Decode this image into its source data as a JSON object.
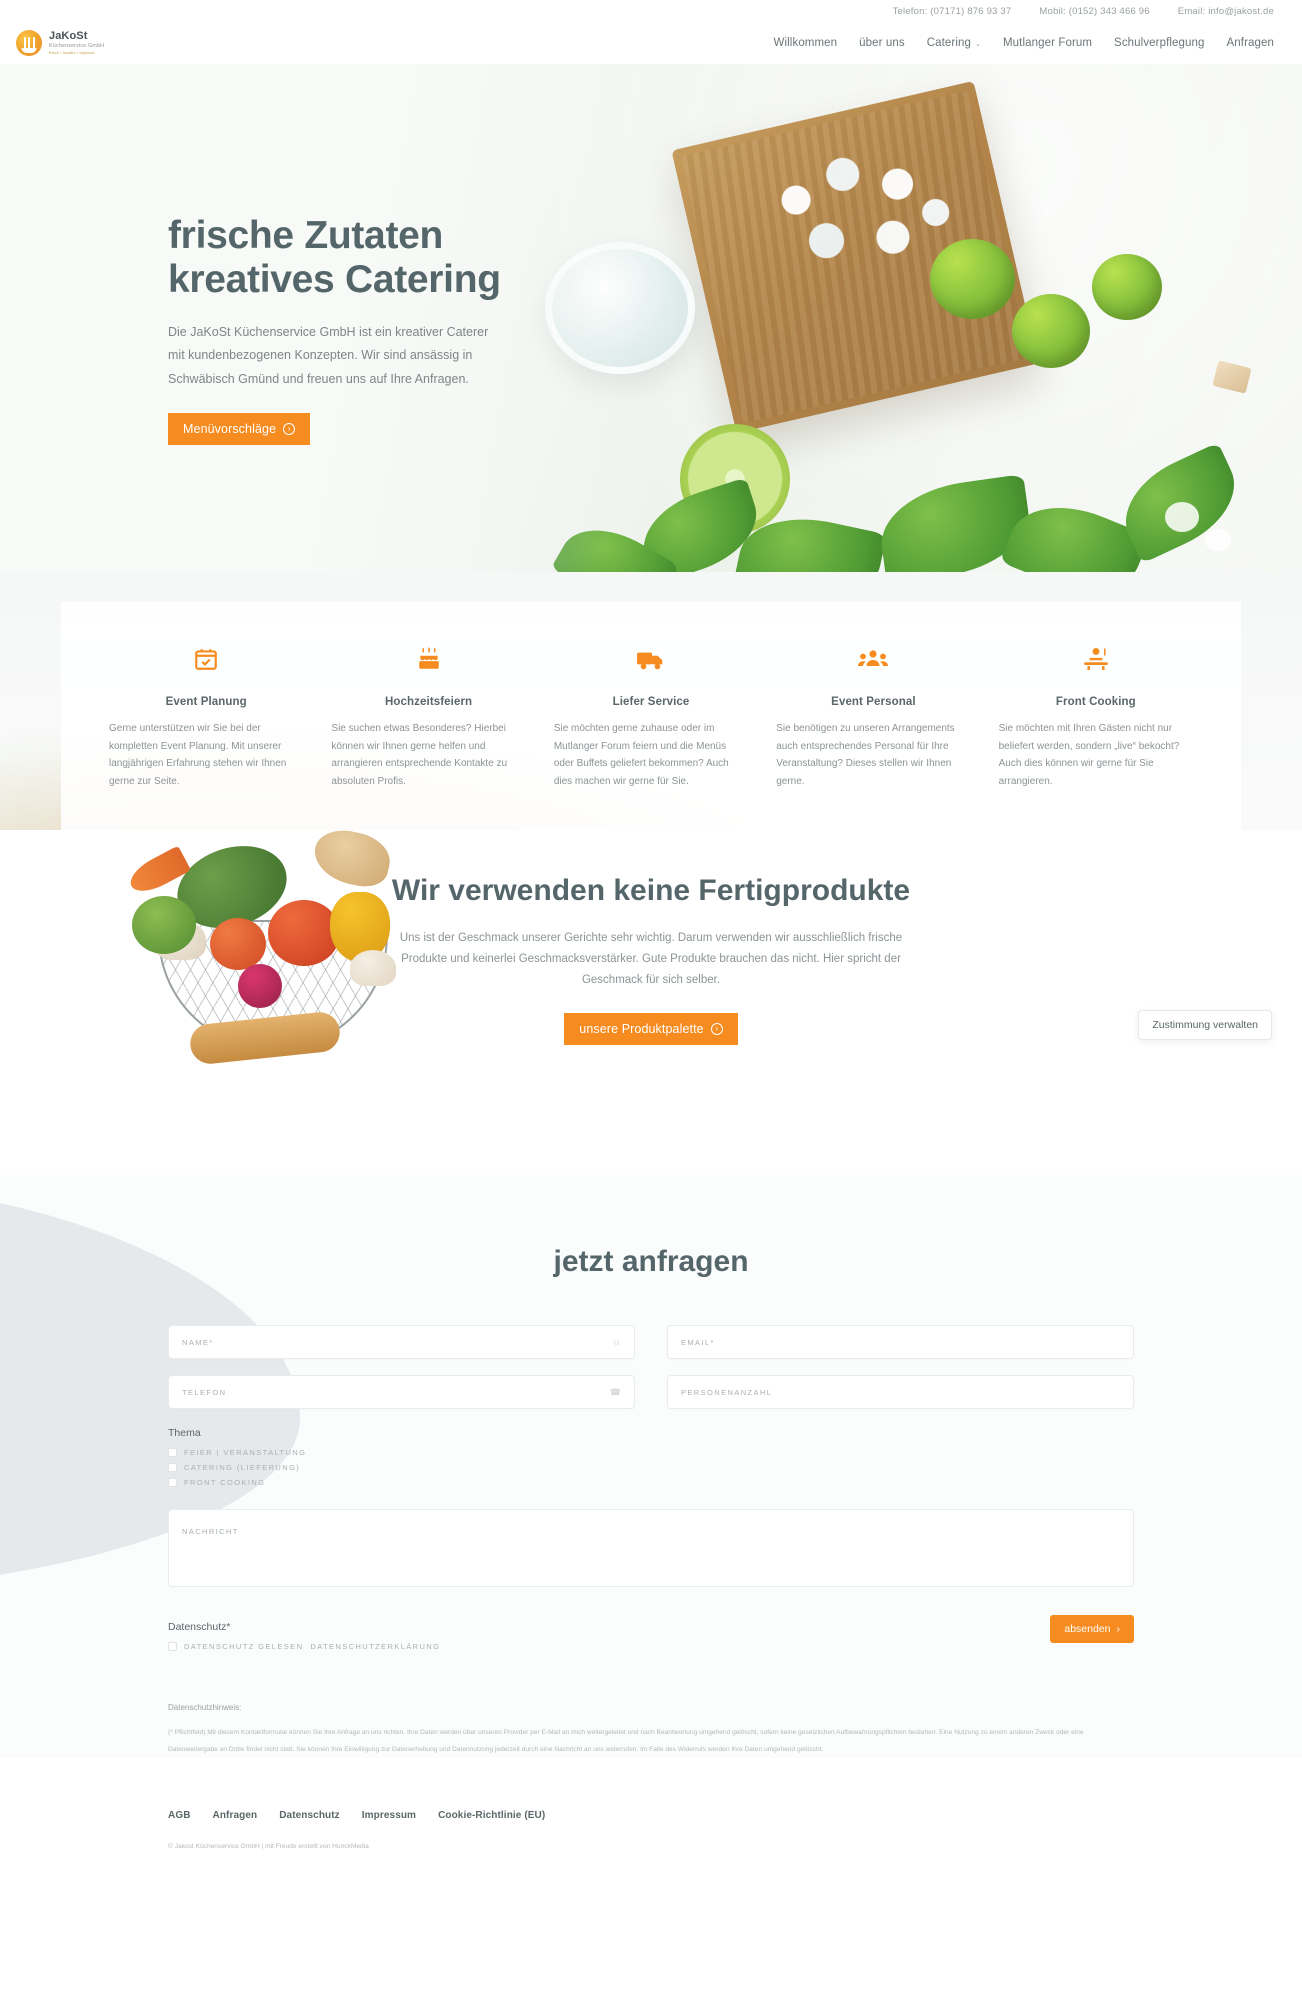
{
  "topbar": {
    "phone": "Telefon: (07171) 876 93 37",
    "mobile": "Mobil: (0152) 343 466 96",
    "email": "Email: info@jakost.de"
  },
  "logo": {
    "title": "JaKoSt",
    "subtitle": "Küchenservice GmbH",
    "tagline": "frisch • kreativ • regional"
  },
  "nav": {
    "items": [
      {
        "label": "Willkommen",
        "has_dropdown": false
      },
      {
        "label": "über uns",
        "has_dropdown": false
      },
      {
        "label": "Catering",
        "has_dropdown": true
      },
      {
        "label": "Mutlanger Forum",
        "has_dropdown": false
      },
      {
        "label": "Schulverpflegung",
        "has_dropdown": false
      },
      {
        "label": "Anfragen",
        "has_dropdown": false
      }
    ],
    "caret": "⌄"
  },
  "hero": {
    "heading_line1": "frische Zutaten",
    "heading_line2": "kreatives Catering",
    "paragraph": "Die JaKoSt Küchenservice GmbH ist ein kreativer Caterer mit kundenbezogenen Konzepten. Wir sind ansässig in Schwäbisch Gmünd und freuen uns auf Ihre Anfragen.",
    "cta_label": "Menüvorschläge",
    "cta_arrow": "›"
  },
  "services": [
    {
      "icon": "calendar-check-icon",
      "title": "Event Planung",
      "text": "Gerne unterstützen wir Sie bei der kompletten Event Planung. Mit unserer langjährigen Erfahrung stehen wir Ihnen gerne zur Seite."
    },
    {
      "icon": "cake-icon",
      "title": "Hochzeitsfeiern",
      "text": "Sie suchen etwas Besonderes? Hierbei können wir Ihnen gerne helfen und arrangieren entsprechende Kontakte zu absoluten Profis."
    },
    {
      "icon": "delivery-truck-icon",
      "title": "Liefer Service",
      "text": "Sie möchten gerne zuhause oder im Mutlanger Forum feiern und die Menüs oder Buffets geliefert bekommen? Auch dies machen wir gerne für Sie."
    },
    {
      "icon": "people-group-icon",
      "title": "Event Personal",
      "text": "Sie benötigen zu unseren Arrangements auch entsprechendes Personal für Ihre Veranstaltung? Dieses stellen wir Ihnen gerne."
    },
    {
      "icon": "chef-cooking-icon",
      "title": "Front Cooking",
      "text": "Sie möchten mit Ihren Gästen nicht nur beliefert werden, sondern „live“ bekocht? Auch dies können wir gerne für Sie arrangieren."
    }
  ],
  "fresh": {
    "heading": "Wir verwenden keine Fertigprodukte",
    "paragraph": "Uns ist der Geschmack unserer Gerichte sehr wichtig. Darum verwenden wir ausschließlich frische Produkte und keinerlei Geschmacksverstärker. Gute Produkte brauchen das nicht. Hier spricht der Geschmack für sich selber.",
    "cta_label": "unsere Produktpalette",
    "cta_arrow": "›"
  },
  "consent_badge": {
    "label": "Zustimmung verwalten"
  },
  "form": {
    "title": "jetzt anfragen",
    "fields": {
      "name": {
        "label": "NAME*",
        "value": "",
        "icon": "user-icon"
      },
      "email": {
        "label": "EMAIL*",
        "value": "",
        "icon": ""
      },
      "telefon": {
        "label": "TELEFON",
        "value": "",
        "icon": "phone-icon"
      },
      "personenanzahl": {
        "label": "PERSONENANZAHL",
        "value": "",
        "icon": ""
      },
      "nachricht": {
        "label": "NACHRICHT",
        "value": ""
      }
    },
    "thema_label": "Thema",
    "thema_options": [
      "FEIER | VERANSTALTUNG",
      "CATERING (LIEFERUNG)",
      "FRONT COOKING"
    ],
    "datenschutz_label": "Datenschutz*",
    "datenschutz_check": "DATENSCHUTZ GELESEN",
    "datenschutz_link": "DATENSCHUTZERKLÄRUNG",
    "submit_label": "absenden",
    "submit_arrow": "›"
  },
  "privacy": {
    "heading": "Datenschutzhinweis:",
    "text": "(* Pflichtfeld) Mit diesem Kontaktformular können Sie Ihre Anfrage an uns richten. Ihre Daten werden über unseren Provider per E-Mail an mich weitergeleitet und nach Beantwortung umgehend gelöscht, sofern keine gesetzlichen Aufbewahrungspflichten bestehen. Eine Nutzung zu einem anderen Zweck oder eine Datenweitergabe an Dritte findet nicht statt. Sie können Ihre Einwilligung zur Datenerhebung und Datennutzung jederzeit durch eine Nachricht an uns widerrufen. Im Falle des Widerrufs werden Ihre Daten umgehend gelöscht."
  },
  "footer": {
    "links": [
      "AGB",
      "Anfragen",
      "Datenschutz",
      "Impressum",
      "Cookie-Richtlinie (EU)"
    ],
    "copyright": "© Jakost Küchenservice GmbH | mit Freude erstellt von HunckMedia"
  },
  "colors": {
    "accent": "#f68b1f",
    "heading": "#55666a",
    "body": "#8c9496"
  }
}
